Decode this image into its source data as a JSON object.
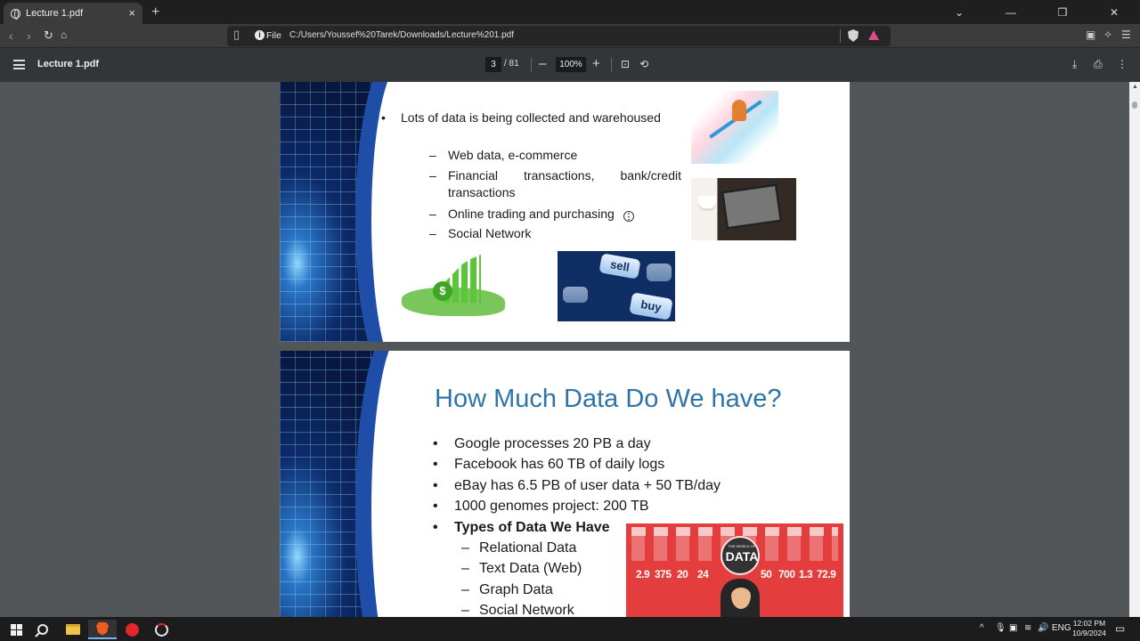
{
  "browser": {
    "tab_title": "Lecture 1.pdf",
    "tab_close": "×",
    "new_tab": "+",
    "window_controls": [
      "⌄",
      "—",
      "❐",
      "✕"
    ],
    "address": {
      "scheme_label": "File",
      "url": "C:/Users/Youssef%20Tarek/Downloads/Lecture%201.pdf"
    }
  },
  "pdf_toolbar": {
    "title": "Lecture 1.pdf",
    "current_page": "3",
    "total_pages": "/ 81",
    "zoom": "100%",
    "zoom_out": "–",
    "zoom_in": "+"
  },
  "slide1": {
    "main_bullet": "Lots of data is being collected and warehoused",
    "sub_bullets": [
      "Web data, e-commerce",
      "Financial transactions, bank/credit transactions",
      "Online trading and purchasing",
      "Social Network"
    ],
    "key_sell": "sell",
    "key_buy": "buy"
  },
  "slide2": {
    "title": "How Much Data Do We have?",
    "bullets": [
      "Google processes 20 PB a day",
      "Facebook has 60 TB of daily logs",
      "eBay has 6.5 PB of user data + 50 TB/day",
      "1000 genomes project: 200 TB"
    ],
    "types_heading": "Types of Data We Have",
    "types": [
      "Relational Data",
      "Text Data (Web)",
      "Graph Data",
      "Social Network"
    ],
    "infographic": {
      "kicker": "THE WORLD OF",
      "word": "DATA",
      "numbers": [
        "2.9",
        "375",
        "20",
        "24",
        "50",
        "700",
        "1.3",
        "72.9"
      ]
    }
  },
  "taskbar": {
    "tray_language": "ENG",
    "time": "12:02 PM",
    "date": "10/9/2024"
  }
}
